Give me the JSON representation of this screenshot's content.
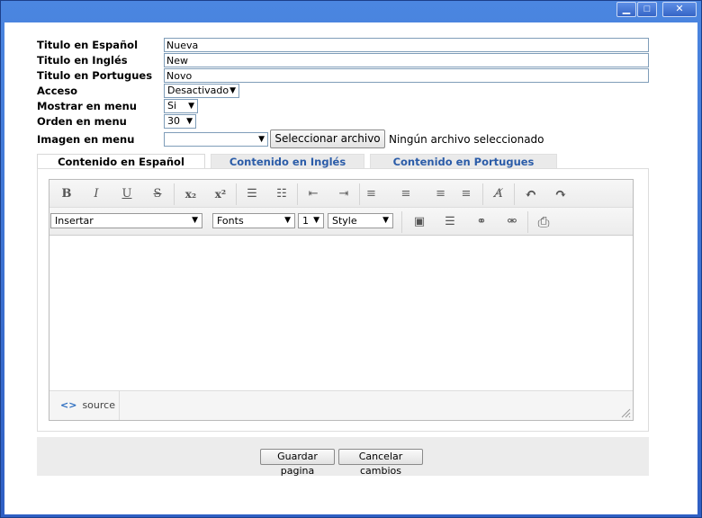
{
  "window": {
    "min_glyph": "▁",
    "max_glyph": "□",
    "close_glyph": "✕"
  },
  "form": {
    "titulo_es": {
      "label": "Titulo en Español",
      "value": "Nueva"
    },
    "titulo_en": {
      "label": "Titulo en Inglés",
      "value": "New"
    },
    "titulo_pt": {
      "label": "Titulo en Portugues",
      "value": "Novo"
    },
    "acceso": {
      "label": "Acceso",
      "value": "Desactivado"
    },
    "mostrar": {
      "label": "Mostrar en menu",
      "value": "Si"
    },
    "orden": {
      "label": "Orden en menu",
      "value": "30"
    },
    "imagen": {
      "label": "Imagen en menu",
      "value": "",
      "file_button": "Seleccionar archivo",
      "file_status": "Ningún archivo seleccionado"
    }
  },
  "tabs": [
    {
      "label": "Contenido en Español",
      "active": true
    },
    {
      "label": "Contenido en Inglés",
      "active": false
    },
    {
      "label": "Contenido en Portugues",
      "active": false
    }
  ],
  "editor": {
    "toolbar1": [
      {
        "name": "bold-icon",
        "glyph": "B"
      },
      {
        "name": "italic-icon",
        "glyph": "I"
      },
      {
        "name": "underline-icon",
        "glyph": "U"
      },
      {
        "name": "strikethrough-icon",
        "glyph": "S"
      },
      {
        "name": "subscript-icon",
        "glyph": "x₂"
      },
      {
        "name": "superscript-icon",
        "glyph": "x²"
      },
      {
        "name": "ordered-list-icon",
        "glyph": "☰"
      },
      {
        "name": "unordered-list-icon",
        "glyph": "☷"
      },
      {
        "name": "outdent-icon",
        "glyph": "⇤"
      },
      {
        "name": "indent-icon",
        "glyph": "⇥"
      },
      {
        "name": "align-left-icon",
        "glyph": "≡"
      },
      {
        "name": "align-center-icon",
        "glyph": "≡"
      },
      {
        "name": "align-right-icon",
        "glyph": "≡"
      },
      {
        "name": "align-justify-icon",
        "glyph": "≡"
      },
      {
        "name": "remove-format-icon",
        "glyph": "A̸"
      },
      {
        "name": "undo-icon",
        "glyph": "↶"
      },
      {
        "name": "redo-icon",
        "glyph": "↷"
      }
    ],
    "insert_select": "Insertar",
    "fonts_select": "Fonts",
    "size_select": "1",
    "style_select": "Style",
    "toolbar2": [
      {
        "name": "image-icon",
        "glyph": "▣"
      },
      {
        "name": "horizontal-rule-icon",
        "glyph": "☰"
      },
      {
        "name": "link-icon",
        "glyph": "⚭"
      },
      {
        "name": "unlink-icon",
        "glyph": "⚮"
      },
      {
        "name": "print-icon",
        "glyph": "⎙"
      }
    ],
    "source_code_glyph": "<>",
    "source_label": "source"
  },
  "actions": {
    "save_label": "Guardar pagina",
    "cancel_label": "Cancelar cambios"
  },
  "colors": {
    "window_blue": "#3b6ccc",
    "tab_link": "#2b5ca8"
  }
}
